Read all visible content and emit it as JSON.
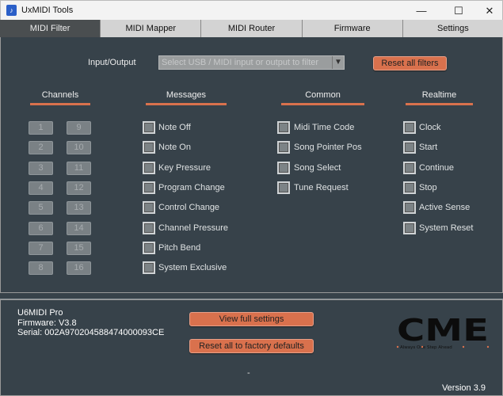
{
  "window": {
    "title": "UxMIDI Tools",
    "minimize": "—",
    "maximize": "☐",
    "close": "✕"
  },
  "tabs": [
    {
      "label": "MIDI Filter",
      "active": true
    },
    {
      "label": "MIDI Mapper"
    },
    {
      "label": "MIDI Router"
    },
    {
      "label": "Firmware"
    },
    {
      "label": "Settings"
    }
  ],
  "filter": {
    "io_label": "Input/Output",
    "io_placeholder": "Select USB / MIDI input or output to filter",
    "reset_filters": "Reset all filters"
  },
  "headers": {
    "channels": "Channels",
    "messages": "Messages",
    "common": "Common",
    "realtime": "Realtime"
  },
  "channels": [
    "1",
    "2",
    "3",
    "4",
    "5",
    "6",
    "7",
    "8",
    "9",
    "10",
    "11",
    "12",
    "13",
    "14",
    "15",
    "16"
  ],
  "messages": [
    "Note Off",
    "Note On",
    "Key Pressure",
    "Program Change",
    "Control Change",
    "Channel Pressure",
    "Pitch Bend",
    "System Exclusive"
  ],
  "common": [
    "Midi Time Code",
    "Song Pointer Pos",
    "Song Select",
    "Tune Request"
  ],
  "realtime": [
    "Clock",
    "Start",
    "Continue",
    "Stop",
    "Active Sense",
    "System Reset"
  ],
  "device": {
    "name": "U6MIDI Pro",
    "firmware": "Firmware: V3.8",
    "serial": "Serial: 002A970204588474000093CE"
  },
  "buttons": {
    "view_full": "View full settings",
    "factory_reset": "Reset all to factory defaults"
  },
  "logo": {
    "text": "CME",
    "tagline": "Always · One · Step · Ahead"
  },
  "status_dot": "-",
  "version": "Version 3.9",
  "colors": {
    "accent": "#d9714d",
    "background": "#37424a"
  }
}
